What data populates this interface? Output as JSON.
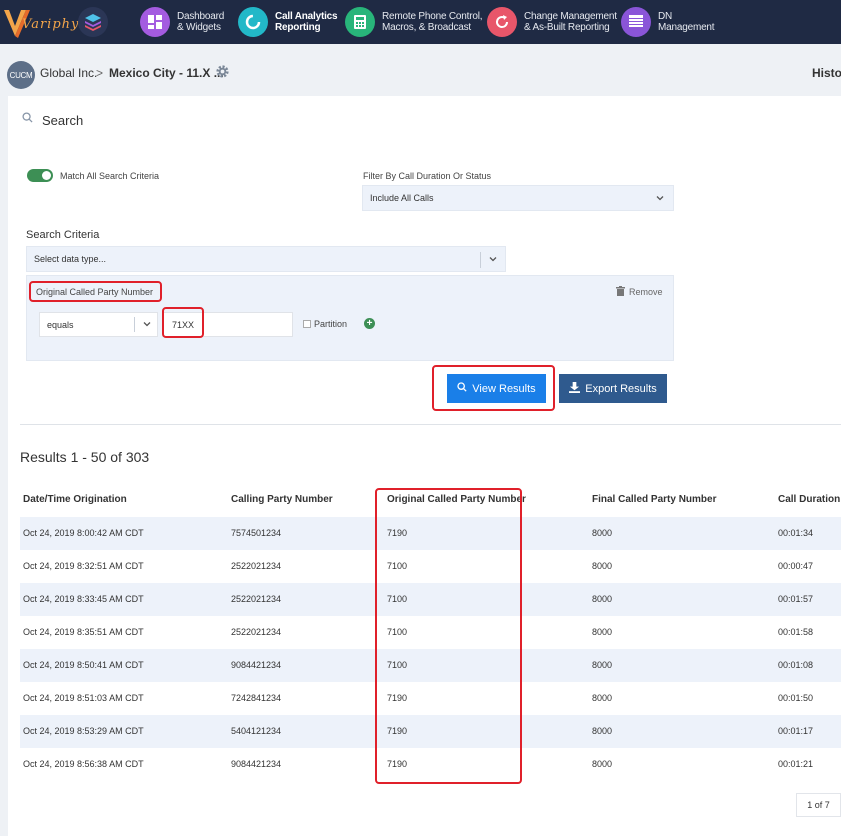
{
  "brand": {
    "logo_text": "Variphy"
  },
  "nav": [
    {
      "line1": "Dashboard",
      "line2": "& Widgets",
      "color": "#a45be0",
      "active": false
    },
    {
      "line1": "Call Analytics",
      "line2": "Reporting",
      "color": "#22b8c8",
      "active": true
    },
    {
      "line1": "Remote Phone Control,",
      "line2": "Macros, & Broadcast",
      "color": "#28b57a",
      "active": false
    },
    {
      "line1": "Change Management",
      "line2": "& As-Built Reporting",
      "color": "#e8566a",
      "active": false
    },
    {
      "line1": "DN",
      "line2": "Management",
      "color": "#8a55d8",
      "active": false
    }
  ],
  "breadcrumb": {
    "avatar": "CUCM",
    "org": "Global Inc.",
    "sep": ">",
    "site": "Mexico City - 11.X ...",
    "right": "History"
  },
  "search": {
    "title": "Search",
    "match_all_label": "Match All Search Criteria",
    "match_all_on": true,
    "filter_label": "Filter By Call Duration Or Status",
    "filter_value": "Include All Calls",
    "criteria_label": "Search Criteria",
    "data_type_placeholder": "Select data type...",
    "criterion": {
      "field": "Original Called Party Number",
      "remove_label": "Remove",
      "operator": "equals",
      "value": "71XX",
      "partition_label": "Partition"
    },
    "view_button": "View Results",
    "export_button": "Export Results"
  },
  "results": {
    "title": "Results 1 - 50 of 303",
    "columns": [
      "Date/Time Origination",
      "Calling Party Number",
      "Original Called Party Number",
      "Final Called Party Number",
      "Call Duration (hh:mm:ss)"
    ],
    "rows": [
      [
        "Oct 24, 2019 8:00:42 AM CDT",
        "7574501234",
        "7190",
        "8000",
        "00:01:34"
      ],
      [
        "Oct 24, 2019 8:32:51 AM CDT",
        "2522021234",
        "7100",
        "8000",
        "00:00:47"
      ],
      [
        "Oct 24, 2019 8:33:45 AM CDT",
        "2522021234",
        "7100",
        "8000",
        "00:01:57"
      ],
      [
        "Oct 24, 2019 8:35:51 AM CDT",
        "2522021234",
        "7100",
        "8000",
        "00:01:58"
      ],
      [
        "Oct 24, 2019 8:50:41 AM CDT",
        "9084421234",
        "7100",
        "8000",
        "00:01:08"
      ],
      [
        "Oct 24, 2019 8:51:03 AM CDT",
        "7242841234",
        "7190",
        "8000",
        "00:01:50"
      ],
      [
        "Oct 24, 2019 8:53:29 AM CDT",
        "5404121234",
        "7190",
        "8000",
        "00:01:17"
      ],
      [
        "Oct 24, 2019 8:56:38 AM CDT",
        "9084421234",
        "7190",
        "8000",
        "00:01:21"
      ]
    ],
    "pager": "1 of 7"
  },
  "colors": {
    "nav_bg": "#1f2a44",
    "accent": "#1a7fe8",
    "export": "#2f5a8e",
    "highlight": "#e0202a",
    "toggle": "#3d8f55"
  }
}
